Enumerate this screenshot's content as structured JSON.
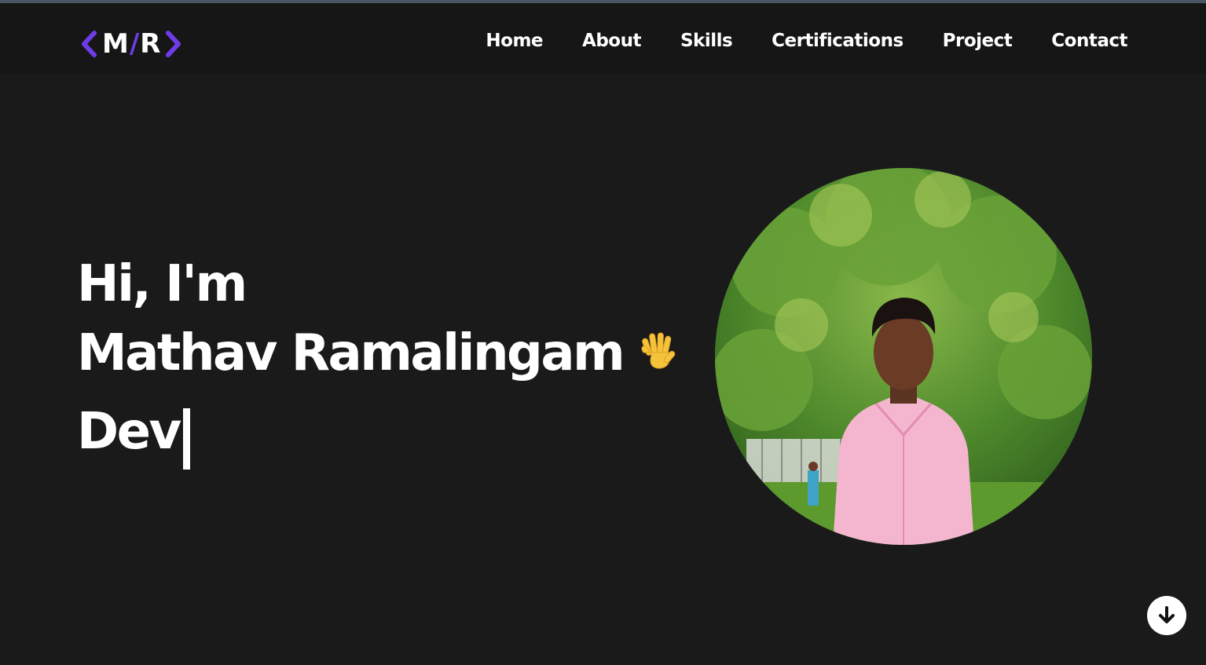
{
  "logo": {
    "left": "<",
    "m": "M",
    "slash": "/",
    "r": "R",
    "right": ">"
  },
  "nav": {
    "items": [
      {
        "label": "Home"
      },
      {
        "label": "About"
      },
      {
        "label": "Skills"
      },
      {
        "label": "Certifications"
      },
      {
        "label": "Project"
      },
      {
        "label": "Contact"
      }
    ]
  },
  "hero": {
    "greeting": "Hi, I'm",
    "name": "Mathav Ramalingam",
    "name_emoji_icon": "waving-hand-icon",
    "typed_role": "Dev"
  },
  "profile_photo": {
    "icon": "profile-photo"
  },
  "scroll_button": {
    "icon": "arrow-down-icon"
  },
  "colors": {
    "background": "#1a1a1b",
    "navbar": "#161617",
    "accent": "#6d3ce6",
    "text": "#ffffff",
    "top_border": "#4a5663"
  }
}
